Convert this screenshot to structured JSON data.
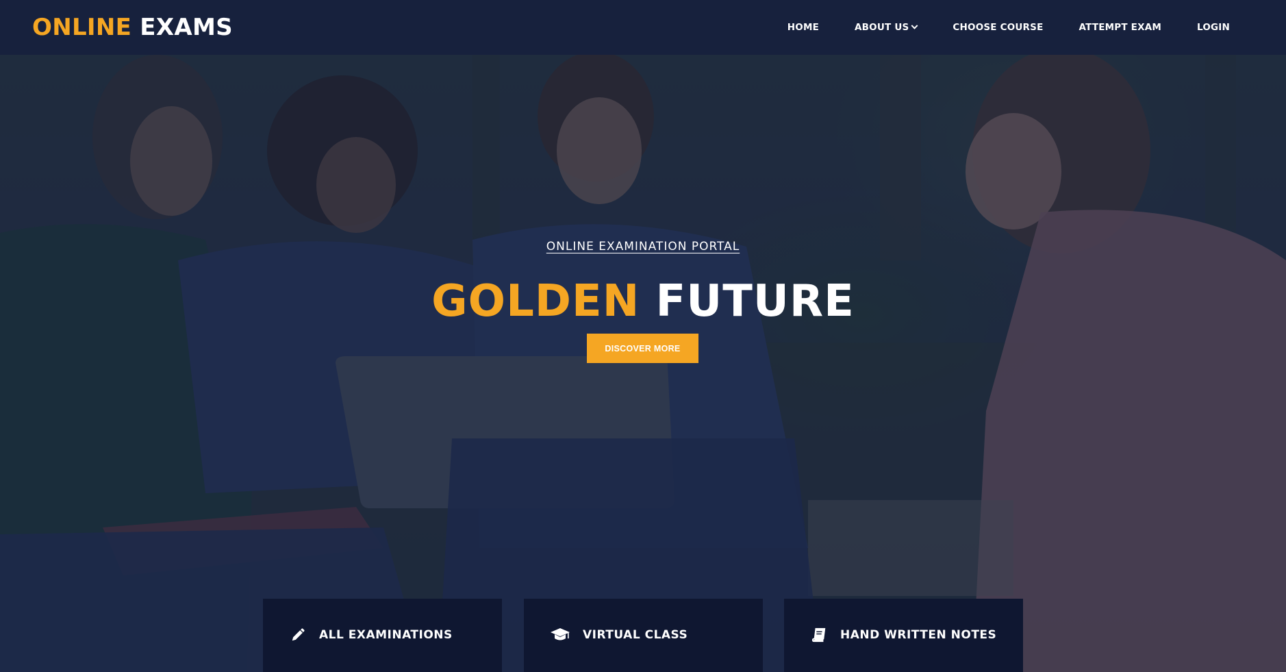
{
  "brand": {
    "accent_word": "ONLINE",
    "plain_word": "EXAMS"
  },
  "nav": {
    "items": [
      {
        "label": "HOME"
      },
      {
        "label": "ABOUT US",
        "dropdown": true
      },
      {
        "label": "CHOOSE COURSE"
      },
      {
        "label": "ATTEMPT EXAM"
      },
      {
        "label": "LOGIN"
      }
    ]
  },
  "hero": {
    "eyebrow": "ONLINE EXAMINATION PORTAL",
    "headline_accent": "GOLDEN",
    "headline_plain": "FUTURE",
    "cta_label": "DISCOVER MORE"
  },
  "features": [
    {
      "label": "ALL EXAMINATIONS",
      "icon": "pencil-icon"
    },
    {
      "label": "VIRTUAL CLASS",
      "icon": "graduation-cap-icon"
    },
    {
      "label": "HAND WRITTEN NOTES",
      "icon": "book-icon"
    }
  ],
  "colors": {
    "accent": "#f5a623",
    "navbar": "#17213d",
    "card": "#0f1731",
    "text": "#ffffff"
  }
}
